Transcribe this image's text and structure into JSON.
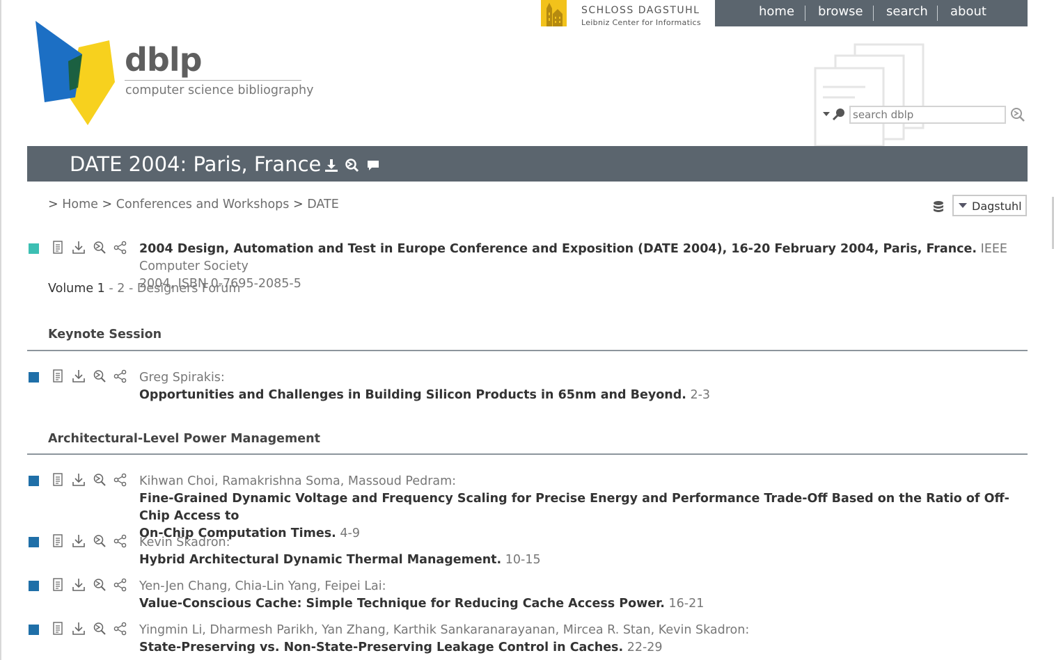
{
  "colors": {
    "nav_bg": "#5b656e",
    "proceedings_marker": "#3cbfb3",
    "inproceedings_marker": "#1f6fa8",
    "dagstuhl_yellow": "#f2c21b",
    "logo_blue": "#1c6fc4",
    "logo_yellow": "#f7d11e"
  },
  "header": {
    "dagstuhl": {
      "line1": "SCHLOSS DAGSTUHL",
      "line2": "Leibniz Center for Informatics"
    },
    "nav": [
      "home",
      "browse",
      "search",
      "about"
    ],
    "logo_word": "dblp",
    "logo_sub": "computer science bibliography",
    "search_placeholder": "search dblp"
  },
  "banner": {
    "title": "DATE 2004: Paris, France",
    "icons": [
      "download-icon",
      "reload-icon",
      "comment-icon"
    ]
  },
  "breadcrumb": {
    "prefix": ">",
    "items": [
      "Home",
      "Conferences and Workshops",
      "DATE"
    ],
    "sep": ">"
  },
  "mirror": {
    "label": "Dagstuhl"
  },
  "entry_icons": [
    "document-icon",
    "download-icon",
    "reload-icon",
    "share-icon"
  ],
  "proceedings": {
    "title": "2004 Design, Automation and Test in Europe Conference and Exposition (DATE 2004), 16-20 February 2004, Paris, France.",
    "pub_line1": "IEEE Computer Society",
    "pub_line2": "2004, ISBN 0-7695-2085-5"
  },
  "volumes": {
    "prefix": "Volume ",
    "current": "1",
    "sep": " - ",
    "others": [
      "2",
      "Designers Forum"
    ]
  },
  "sections": [
    {
      "title": "Keynote Session",
      "entries": [
        {
          "authors": "Greg Spirakis:",
          "title": "Opportunities and Challenges in Building Silicon Products in 65nm and Beyond.",
          "pages": "2-3"
        }
      ]
    },
    {
      "title": "Architectural-Level Power Management",
      "entries": [
        {
          "authors": "Kihwan Choi, Ramakrishna Soma, Massoud Pedram:",
          "title_line1": "Fine-Grained Dynamic Voltage and Frequency Scaling for Precise Energy and Performance Trade-Off Based on the Ratio of Off-Chip Access to",
          "title_line2": "On-Chip Computation Times.",
          "pages": "4-9"
        },
        {
          "authors": "Kevin Skadron:",
          "title": "Hybrid Architectural Dynamic Thermal Management.",
          "pages": "10-15"
        },
        {
          "authors": "Yen-Jen Chang, Chia-Lin Yang, Feipei Lai:",
          "title": "Value-Conscious Cache: Simple Technique for Reducing Cache Access Power.",
          "pages": "16-21"
        },
        {
          "authors": "Yingmin Li, Dharmesh Parikh, Yan Zhang, Karthik Sankaranarayanan, Mircea R. Stan, Kevin Skadron:",
          "title": "State-Preserving vs. Non-State-Preserving Leakage Control in Caches.",
          "pages": "22-29"
        }
      ]
    }
  ]
}
